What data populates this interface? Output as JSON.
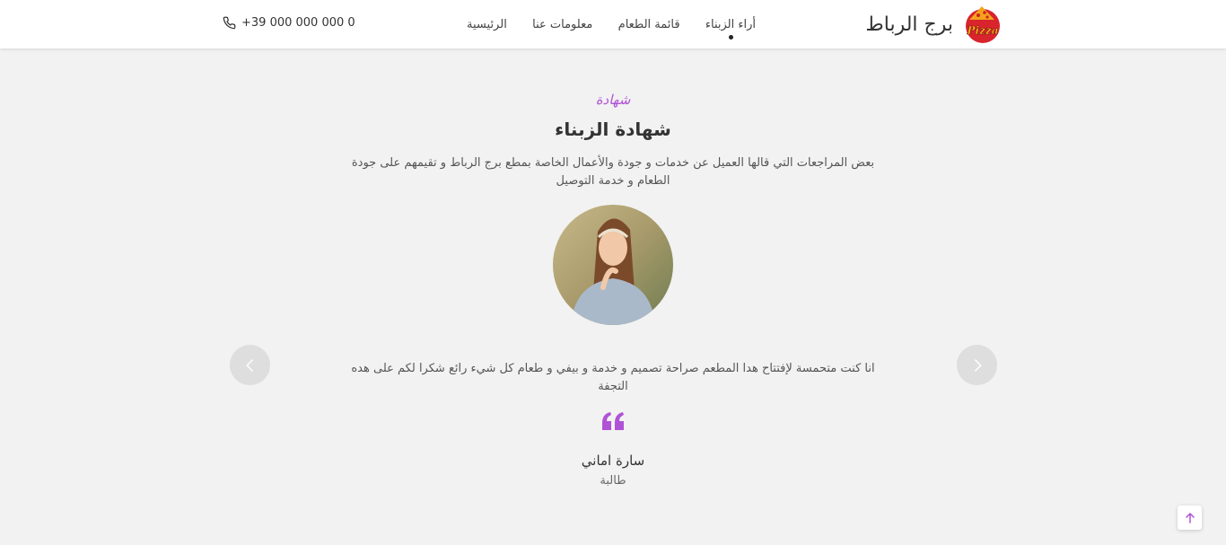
{
  "header": {
    "brand_name": "برج الرباط",
    "logo_text": "Pizza",
    "nav": [
      {
        "label": "الرئيسية",
        "active": false
      },
      {
        "label": "معلومات عنا",
        "active": false
      },
      {
        "label": "قائمة الطعام",
        "active": false
      },
      {
        "label": "أراء الزبناء",
        "active": true
      }
    ],
    "phone": "+39 000 000 000 0"
  },
  "testimonials": {
    "subtitle": "شهادة",
    "title": "شهادة الزبناء",
    "description": "بعض المراجعات التي قالها العميل عن خدمات و جودة والأعمال الخاصة بمطع برج الرباط و تقيمهم على جودة الطعام و خدمة التوصيل",
    "quote": "انا كنت متحمسة لإفتتاح هدا المطعم صراحة تصميم و خدمة و بيفي و طعام كل شيء رائع شكرا لكم على هده التجفة",
    "author_name": "سارة اماني",
    "author_role": "طالبة"
  },
  "colors": {
    "accent": "#b052d6",
    "section_bg": "#f2f2f2",
    "logo_red": "#d9232d"
  }
}
